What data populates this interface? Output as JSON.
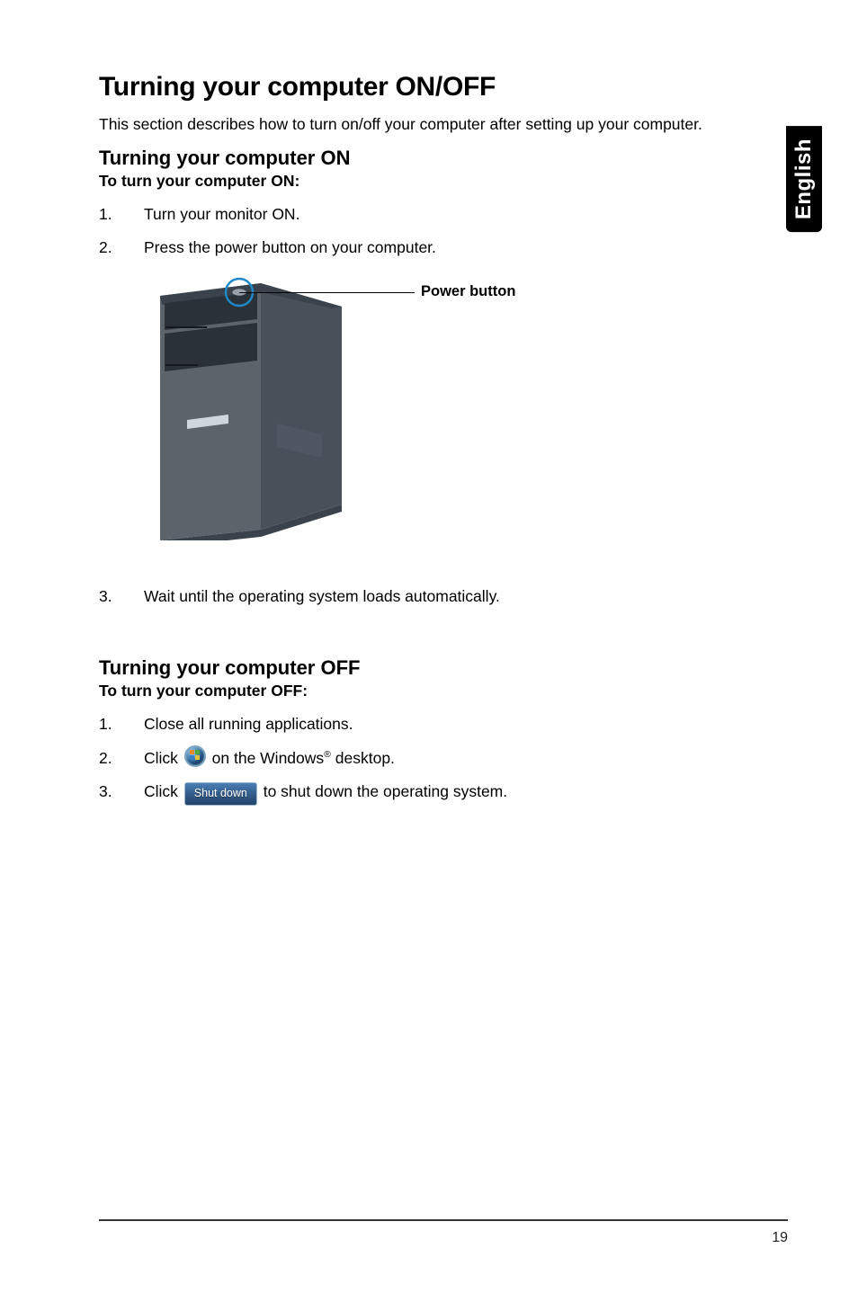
{
  "side_tab": "English",
  "title": "Turning your computer ON/OFF",
  "intro": "This section describes how to turn on/off your computer after setting up your computer.",
  "on_section": {
    "heading": "Turning your computer ON",
    "subheading": "To turn your computer ON:",
    "steps": [
      {
        "num": "1.",
        "text": "Turn your monitor ON."
      },
      {
        "num": "2.",
        "text": "Press the power button on your computer."
      },
      {
        "num": "3.",
        "text": "Wait until the operating system loads automatically."
      }
    ],
    "figure": {
      "callout": "Power button"
    }
  },
  "off_section": {
    "heading": "Turning your computer OFF",
    "subheading": "To turn your computer OFF:",
    "steps": [
      {
        "num": "1.",
        "text": "Close all running applications."
      },
      {
        "num": "2.",
        "pre": "Click ",
        "post": " on the Windows",
        "suffix": " desktop."
      },
      {
        "num": "3.",
        "pre": "Click ",
        "btn": "Shut down",
        "post": " to shut down the operating system."
      }
    ]
  },
  "page_number": "19"
}
